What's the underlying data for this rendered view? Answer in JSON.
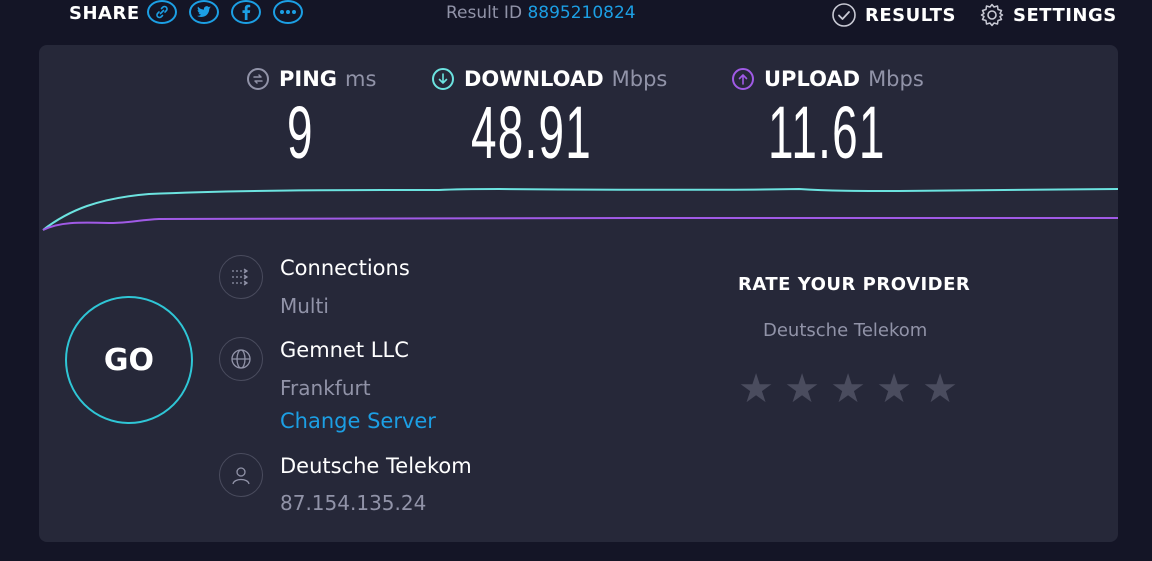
{
  "header": {
    "share_label": "SHARE",
    "share_icons": [
      "link-icon",
      "twitter-icon",
      "facebook-icon",
      "more-icon"
    ],
    "result_id_label": "Result ID",
    "result_id_value": "8895210824",
    "results_label": "RESULTS",
    "settings_label": "SETTINGS"
  },
  "metrics": {
    "ping": {
      "name": "PING",
      "unit": "ms",
      "value": "9"
    },
    "download": {
      "name": "DOWNLOAD",
      "unit": "Mbps",
      "value": "48.91"
    },
    "upload": {
      "name": "UPLOAD",
      "unit": "Mbps",
      "value": "11.61"
    }
  },
  "colors": {
    "accent": "#1c9fe4",
    "download": "#6ce3e0",
    "upload": "#a05ae6",
    "background": "#141526",
    "panel": "#262839"
  },
  "go_button": "GO",
  "connections": {
    "title": "Connections",
    "value": "Multi"
  },
  "server": {
    "name": "Gemnet LLC",
    "location": "Frankfurt",
    "change_label": "Change Server"
  },
  "provider": {
    "name": "Deutsche Telekom",
    "ip": "87.154.135.24"
  },
  "rate": {
    "title": "RATE YOUR PROVIDER",
    "provider": "Deutsche Telekom",
    "stars_total": 5,
    "stars_selected": 0
  }
}
